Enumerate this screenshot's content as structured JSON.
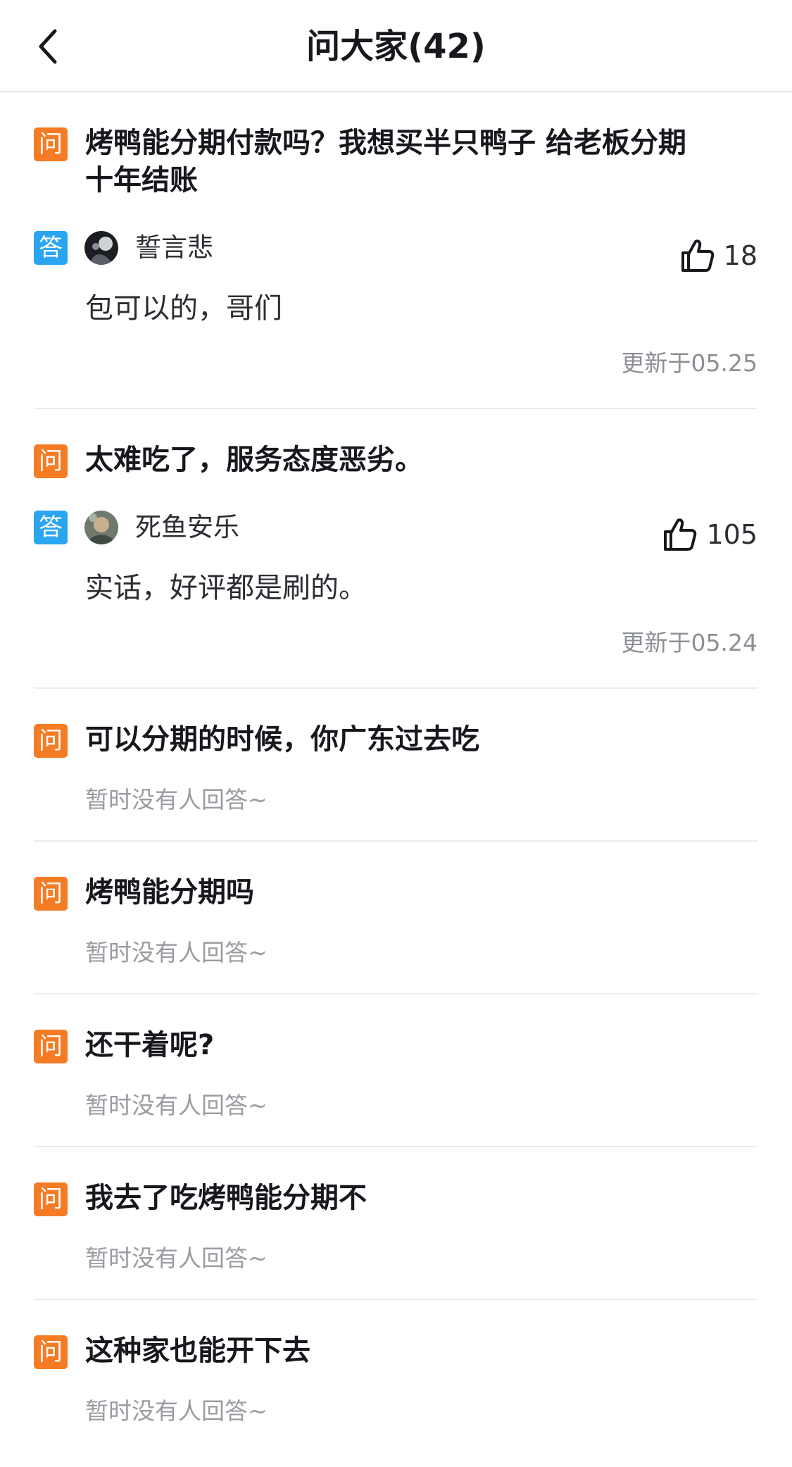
{
  "header": {
    "title": "问大家(42)"
  },
  "badges": {
    "question": "问",
    "answer": "答"
  },
  "colors": {
    "question_badge": "#f57c24",
    "answer_badge": "#2aa5f2"
  },
  "items": [
    {
      "question": "烤鸭能分期付款吗？我想买半只鸭子 给老板分期十年结账",
      "answer": {
        "username": "誓言悲",
        "likes": "18",
        "text": "包可以的，哥们",
        "updated": "更新于05.25"
      }
    },
    {
      "question": "太难吃了，服务态度恶劣。",
      "answer": {
        "username": "死鱼安乐",
        "likes": "105",
        "text": "实话，好评都是刷的。",
        "updated": "更新于05.24"
      }
    },
    {
      "question": "可以分期的时候，你广东过去吃",
      "no_answer": "暂时没有人回答~"
    },
    {
      "question": "烤鸭能分期吗",
      "no_answer": "暂时没有人回答~"
    },
    {
      "question": "还干着呢?",
      "no_answer": "暂时没有人回答~"
    },
    {
      "question": "我去了吃烤鸭能分期不",
      "no_answer": "暂时没有人回答~"
    },
    {
      "question": "这种家也能开下去",
      "no_answer": "暂时没有人回答~"
    }
  ]
}
